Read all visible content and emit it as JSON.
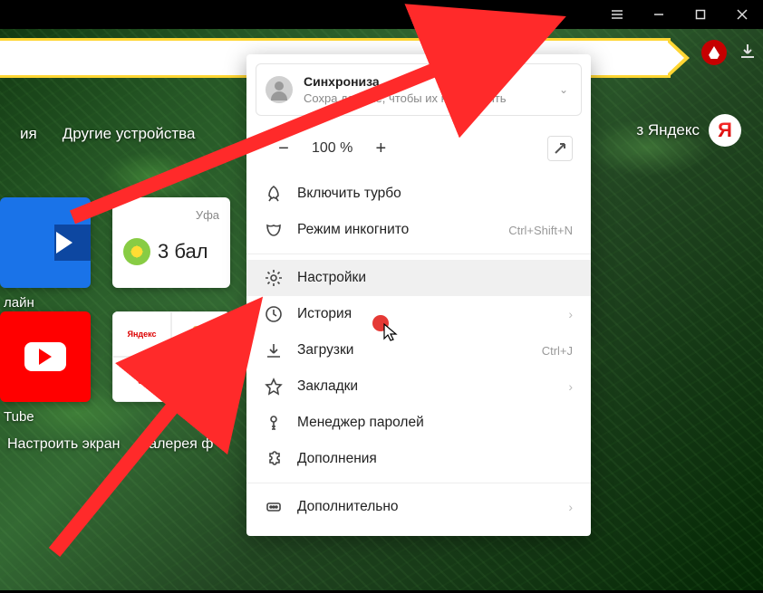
{
  "titlebar": {
    "hamburger": "menu",
    "minimize": "minimize",
    "maximize": "maximize",
    "close": "close"
  },
  "secondary_nav": {
    "item_left_fragment": "ия",
    "other_devices": "Другие устройства",
    "yandex_fragment": "з Яндекс",
    "yandex_logo_letter": "Я"
  },
  "tiles": {
    "online_label": "лайн",
    "tube_label": "Tube",
    "weather_city": "Уфа",
    "weather_text": "3 бал"
  },
  "bottom": {
    "configure_screen": "Настроить экран",
    "gallery": "Галерея ф"
  },
  "menu": {
    "sync": {
      "title": "Синхрониза",
      "subtitle": "Сохра           данные, чтобы их не потерять"
    },
    "zoom": {
      "minus": "−",
      "value": "100 %",
      "plus": "+"
    },
    "turbo": "Включить турбо",
    "incognito": {
      "label": "Режим инкогнито",
      "shortcut": "Ctrl+Shift+N"
    },
    "settings": "Настройки",
    "history": "История",
    "downloads": {
      "label": "Загрузки",
      "shortcut": "Ctrl+J"
    },
    "bookmarks": "Закладки",
    "passwords": "Менеджер паролей",
    "extensions": "Дополнения",
    "more": "Дополнительно"
  }
}
